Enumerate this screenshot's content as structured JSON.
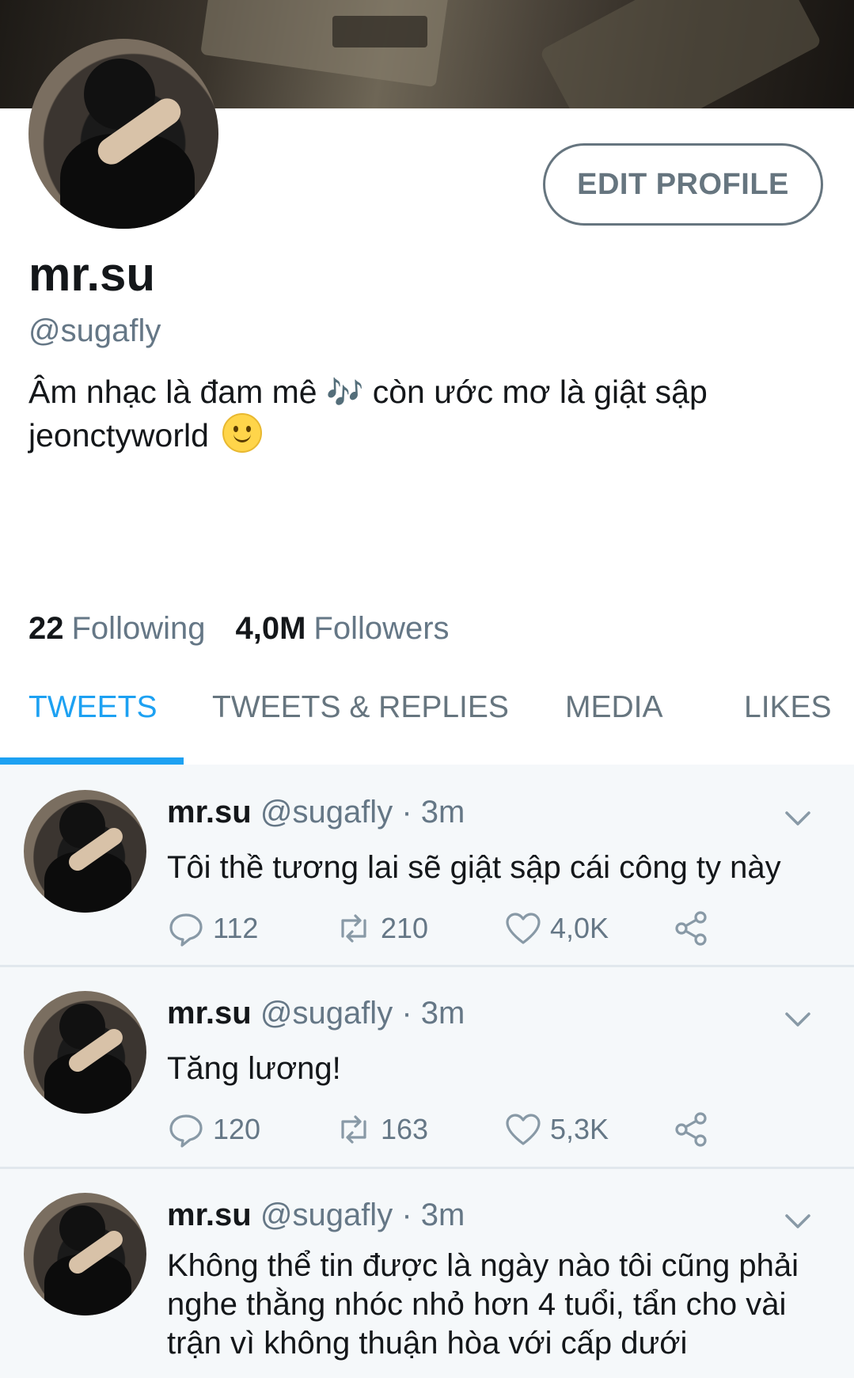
{
  "profile": {
    "name": "mr.su",
    "handle": "@sugafly",
    "bio_part1": "Âm nhạc là đam mê",
    "bio_note": "🎶",
    "bio_part2": " còn ước mơ là giật sập",
    "bio_line2": "jeonctyworld",
    "edit_button": "EDIT PROFILE"
  },
  "stats": {
    "following_count": "22",
    "following_label": "Following",
    "followers_count": "4,0M",
    "followers_label": "Followers"
  },
  "tabs": [
    {
      "label": "TWEETS",
      "active": true
    },
    {
      "label": "TWEETS & REPLIES",
      "active": false
    },
    {
      "label": "MEDIA",
      "active": false
    },
    {
      "label": "LIKES",
      "active": false
    }
  ],
  "tweets": [
    {
      "name": "mr.su",
      "handle": "@sugafly",
      "time": "· 3m",
      "text": "Tôi thề tương lai sẽ giật sập cái công ty này",
      "replies": "112",
      "retweets": "210",
      "likes": "4,0K"
    },
    {
      "name": "mr.su",
      "handle": "@sugafly",
      "time": "· 3m",
      "text": "Tăng lương!",
      "replies": "120",
      "retweets": "163",
      "likes": "5,3K"
    },
    {
      "name": "mr.su",
      "handle": "@sugafly",
      "time": "· 3m",
      "text": "Không thể tin được là ngày nào tôi cũng phải nghe thằng nhóc nhỏ hơn 4 tuổi, tẩn cho vài trận vì không thuận hòa với cấp dưới",
      "replies": "",
      "retweets": "",
      "likes": ""
    }
  ],
  "colors": {
    "accent": "#1da1f2",
    "secondary_text": "#657786",
    "feed_bg": "#f5f8fa"
  }
}
